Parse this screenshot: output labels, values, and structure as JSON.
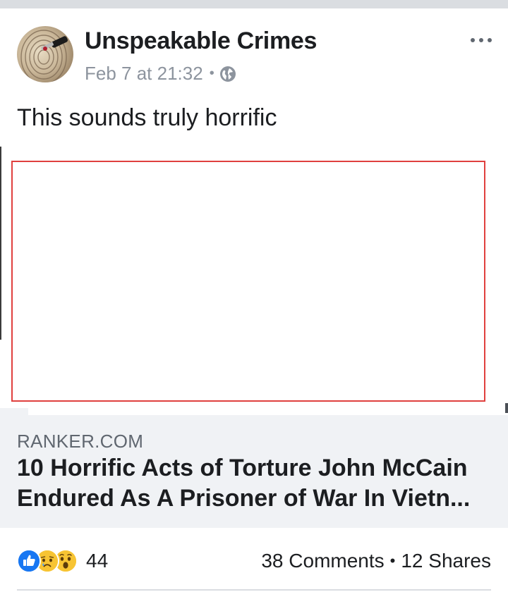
{
  "post": {
    "page_name": "Unspeakable Crimes",
    "timestamp": "Feb 7 at 21:32",
    "meta_separator": "•",
    "privacy_icon": "globe-icon",
    "text": "This sounds truly horrific"
  },
  "link_preview": {
    "domain": "RANKER.COM",
    "title_line1": "10 Horrific Acts of Torture John McCain",
    "title_line2": "Endured As A Prisoner of War In Vietn..."
  },
  "engagement": {
    "reaction_icons": [
      "like-icon",
      "sad-icon",
      "wow-icon"
    ],
    "reaction_count": "44",
    "comments": "38 Comments",
    "separator": "•",
    "shares": "12 Shares"
  },
  "colors": {
    "like_blue": "#1877f2",
    "emoji_yellow": "#f7c433",
    "image_border": "#e0403e",
    "link_card_bg": "#f0f2f5"
  }
}
